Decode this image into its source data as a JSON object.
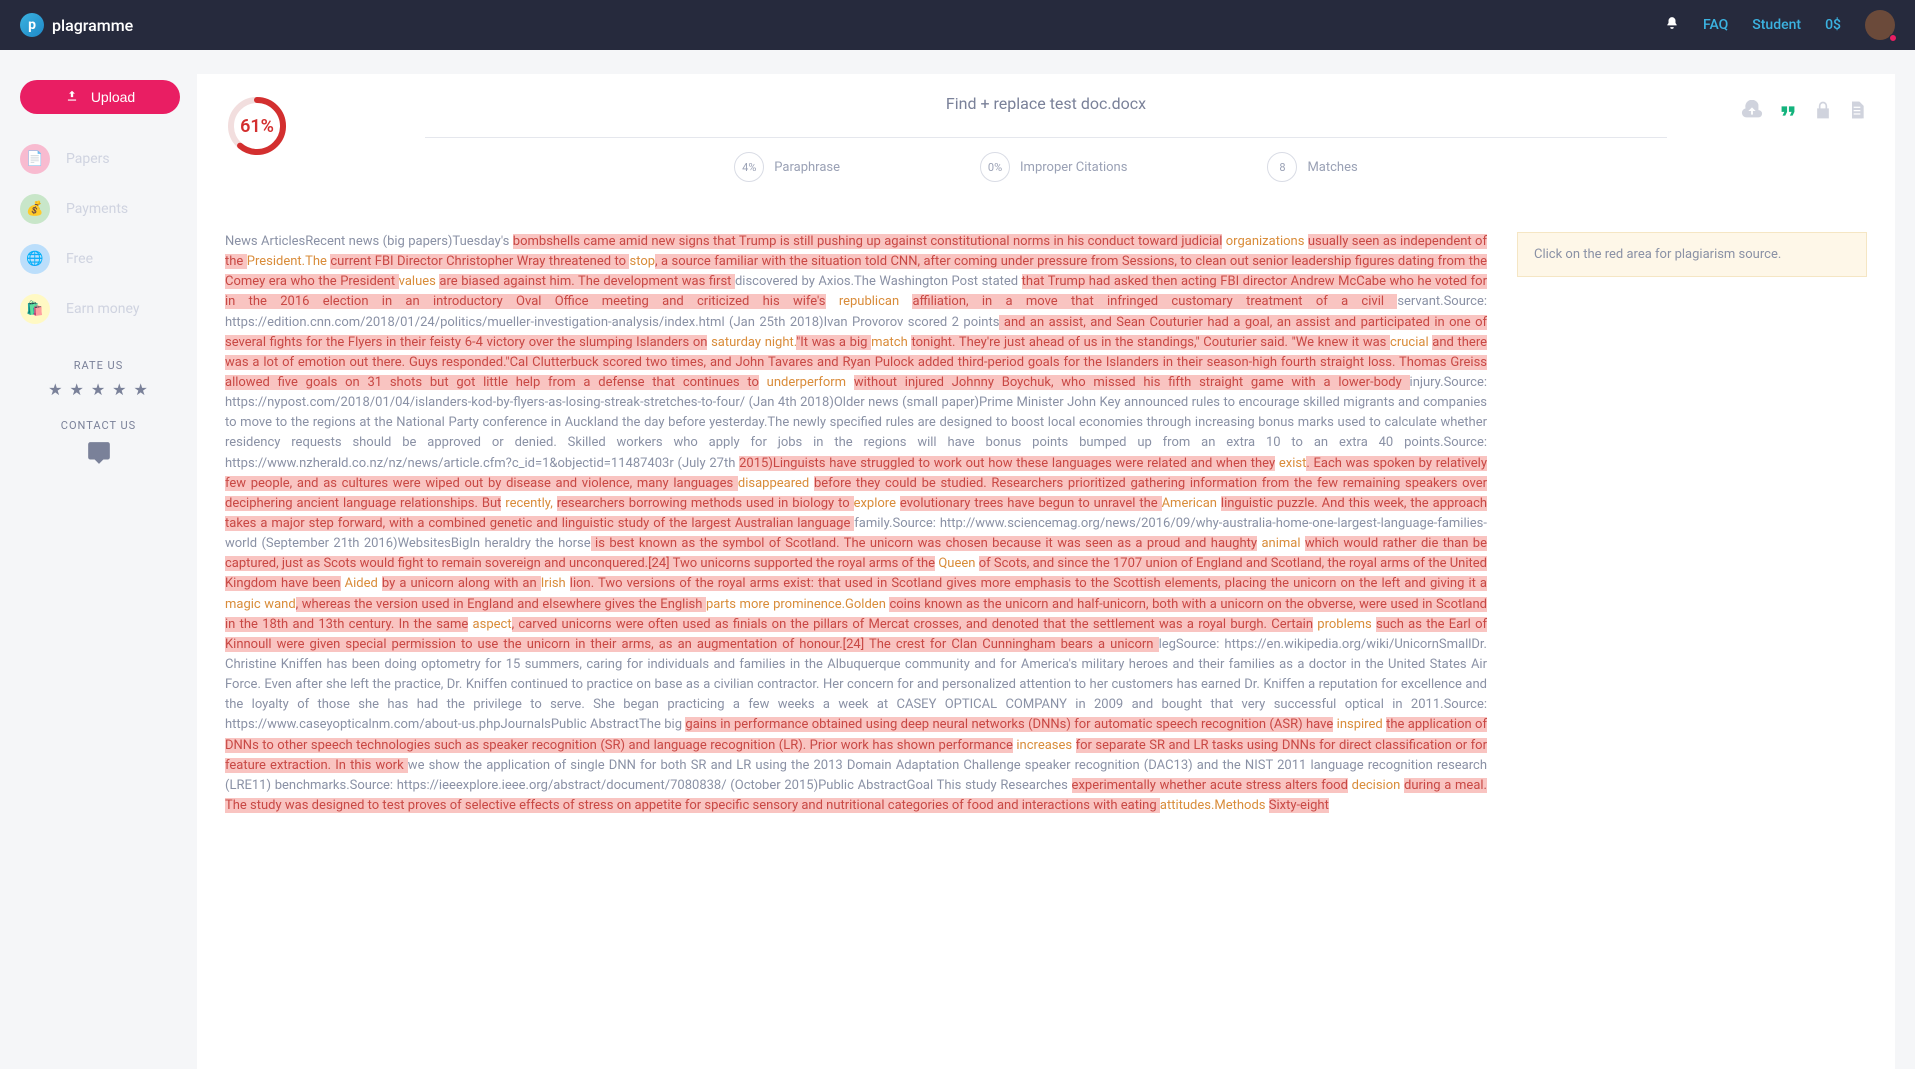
{
  "header": {
    "logo_text": "plagramme",
    "faq": "FAQ",
    "student": "Student",
    "balance": "0$"
  },
  "sidebar": {
    "upload": "Upload",
    "items": {
      "papers": "Papers",
      "payments": "Payments",
      "free": "Free",
      "earn": "Earn money"
    },
    "rate_us": "RATE US",
    "contact_us": "CONTACT US"
  },
  "doc": {
    "score": "61%",
    "title": "Find + replace test doc.docx",
    "metrics": {
      "paraphrase_val": "4%",
      "paraphrase_label": "Paraphrase",
      "improper_val": "0%",
      "improper_label": "Improper Citations",
      "matches_val": "8",
      "matches_label": "Matches"
    }
  },
  "info_box": "Click on the red area for plagiarism source.",
  "text": {
    "t1": "News ArticlesRecent news (big papers)Tuesday's ",
    "t2": "bombshells came amid new signs that Trump is still pushing up against constitutional norms in his conduct toward judicial",
    "t3": " organizations ",
    "t4": "usually seen ",
    "t5": "as independent of the ",
    "t6": "President.The ",
    "t7": "current FBI Director Christopher Wray threatened to ",
    "t8": "stop",
    "t9": ", a source familiar with the situation told CNN, after coming under pressure from Sessions, to clean out senior leadership figures dating from the Comey era who the President ",
    "t10": "values ",
    "t11": "are biased against him. ",
    "t12": "The development was first ",
    "t13": "discovered by Axios.The Washington Post stated ",
    "t14": "that Trump had asked then acting FBI director Andrew McCabe who he voted for in the 2016 election in an introductory Oval Office meeting and criticized his wife's",
    "t15": " republican ",
    "t16": "affiliation, in a move that infringed customary treatment of a civil ",
    "t17": "servant.Source: https://edition.cnn.com/2018/01/24/politics/mueller-investigation-analysis/index.html (Jan 25th 2018)Ivan Provorov scored 2 points",
    "t18": " and an assist, and Sean Couturier had a goal, an assist and participated in one of several fights for the Flyers in their feisty 6-4 victory over the slumping Islanders on",
    "t19": " saturday night.",
    "t20": "\"It ",
    "t21": "was a big ",
    "t22": "match ",
    "t23": "tonight. They're just ahead of us in the standings,\" Couturier said. \"We knew it was ",
    "t24": "crucial ",
    "t25": "and there was a lot of emotion out there. Guys responded.\"",
    "t26": "Cal Clutterbuck scored two times",
    "t27": ", and John Tavares and Ryan Pulock added third-period goals for the Islanders in their season-high fourth straight loss. Thomas Greiss allowed five goals on 31 shots but got little help from a defense that continues to",
    "t28": " underperform ",
    "t29": "without injured Johnny Boychuk, who missed his ",
    "t30": "fifth straight game with a lower-body ",
    "t31": "injury.Source: https://nypost.com/2018/01/04/islanders-kod-by-flyers-as-losing-streak-stretches-to-four/ (Jan 4th 2018)Older news (small paper)Prime Minister John Key announced rules to encourage skilled migrants and companies to move to the regions at the National Party conference in Auckland the day before yesterday.The newly specified rules are designed to boost local economies through increasing bonus marks used to calculate whether residency requests should be approved or denied. Skilled workers who apply for jobs in the regions will have bonus points bumped up from an extra 10 to an extra 40 points.Source: https://www.nzherald.co.nz/nz/news/article.cfm?c_id=1&objectid=11487403r (July 27th ",
    "t32": "2015)Linguists have struggled to work out how these languages were related and when they",
    "t33": " exist",
    "t34": ". Each was spoken by relatively few people, and as cultures were wiped out by disease and violence, many languages ",
    "t35": "disappeared ",
    "t36": "before they could be studied. Researchers prioritized gathering information from the few remaining speakers over deciphering ancient language relationships. But",
    "t37": " recently, ",
    "t38": "researchers borrowing methods used in biology to ",
    "t39": "explore ",
    "t40": "evolutionary trees have begun to unravel the ",
    "t41": "American ",
    "t42": "linguistic puzzle. And this week, the approach takes a major step forward, with a combined genetic and linguistic study of the largest Australian language ",
    "t43": "family.Source: http://www.sciencemag.org/news/2016/09/why-australia-home-one-largest-language-families-world (September 21th 2016)WebsitesBigIn heraldry the horse",
    "t44": " is best known as the symbol of Scotland. The unicorn was chosen because it was seen as a proud and haughty",
    "t45": " animal ",
    "t46": "which would rather die than be captured, just as Scots would fight to remain sovereign and unconquered.[24] Two unicorns supported the royal arms of the",
    "t47": " Queen ",
    "t48": "of Scots, and since the 1707 union of England and Scotland, the royal arms of the United Kingdom have been",
    "t49": " Aided ",
    "t50": "by a unicorn along with an ",
    "t51": "Irish ",
    "t52": "lion. Two versions of the royal arms exist: that used in Scotland gives more emphasis to the Scottish elements, placing the unicorn on the left and giving it a",
    "t53": " magic wand",
    "t54": ", whereas the version used in England and elsewhere gives the English ",
    "t55": "parts more prominence.Golden ",
    "t56": "coins known as the unicorn and half-unicorn, both with a unicorn on the obverse, were used in Scotland in the 18th and 13th century. In the same",
    "t57": " aspect",
    "t58": ", carved unicorns were often used as finials on the pillars of Mercat crosses, ",
    "t59": "and denoted that the settlement was a royal burgh. Certain",
    "t60": " problems ",
    "t61": "such as the Earl of Kinnoull were given special permission to use the unicorn in their arms, as an augmentation of honour.[24] ",
    "t62": "The crest for Clan Cunningham bears a unicorn ",
    "t63": "legSource: https://en.wikipedia.org/wiki/UnicornSmallDr. Christine Kniffen has been doing optometry for 15 summers, caring for individuals and families in the Albuquerque community and for America's military heroes and their families as a doctor in the United States Air Force. Even after she left the practice, Dr. Kniffen continued to practice on base as a civilian contractor. Her concern for and personalized attention to her customers has earned Dr. Kniffen a reputation for excellence and the loyalty of those she has had the privilege to serve. She began practicing a few weeks a week at CASEY OPTICAL COMPANY in 2009 and bought that very successful optical in 2011.Source: https://www.caseyopticalnm.com/about-us.phpJournalsPublic AbstractThe big ",
    "t64": "gains in performance obtained using deep neural networks (DNNs) for automatic speech recognition (ASR) have",
    "t65": " inspired ",
    "t66": "the application of DNNs to other speech technologies such as speaker recognition (SR) and language recognition (LR). Prior work has shown performance",
    "t67": " increases ",
    "t68": "for separate SR and LR tasks using DNNs for direct classification or for feature extraction. In this work ",
    "t69": "we show the application of single DNN for both SR and LR using the 2013 Domain Adaptation Challenge speaker recognition (DAC13) and the NIST 2011 language recognition research (LRE11) benchmarks.Source: https://ieeexplore.ieee.org/abstract/document/7080838/ (October 2015)Public AbstractGoal This study Researches ",
    "t70": "experimentally whether acute stress alters food",
    "t71": " decision ",
    "t72": "during a meal. The study was designed to test proves ",
    "t73": "of selective effects of stress on appetite for specific sensory and nutritional categories of food and interactions with eating ",
    "t74": "attitudes.Methods ",
    "t75": "Sixty-eight"
  }
}
